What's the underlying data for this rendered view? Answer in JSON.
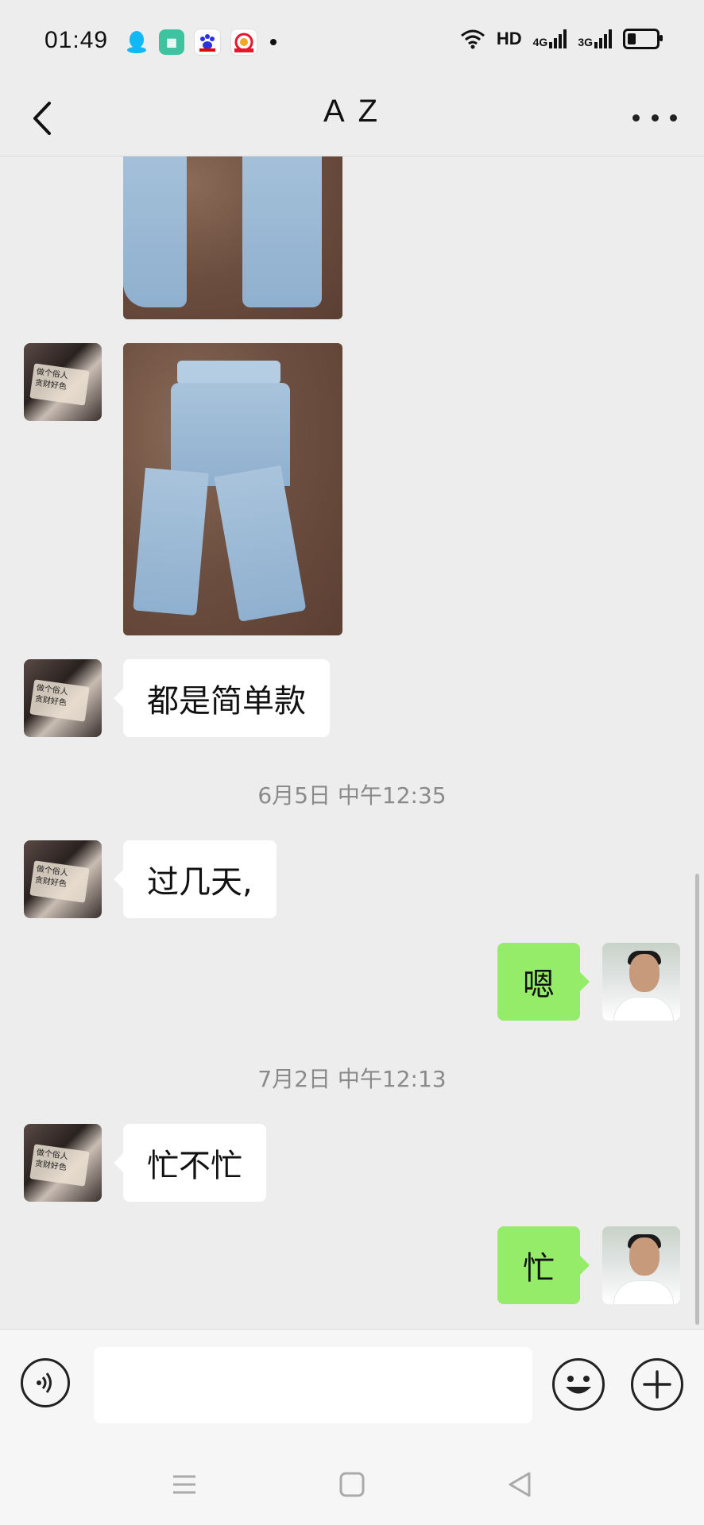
{
  "status_bar": {
    "time": "01:49",
    "app_icons": [
      "qq-icon",
      "app-store-icon",
      "baidu-icon",
      "weibo-icon"
    ],
    "hd_label": "HD",
    "network_1": "4G",
    "network_2": "3G",
    "battery_level": 0.3
  },
  "header": {
    "title": "A Z"
  },
  "messages": [
    {
      "type": "image",
      "side": "left",
      "image_desc": "jeans-photo"
    },
    {
      "type": "image",
      "side": "left",
      "image_desc": "jeans-photo"
    },
    {
      "type": "text",
      "side": "left",
      "text": "都是简单款"
    },
    {
      "type": "timestamp",
      "text": "6月5日 中午12:35"
    },
    {
      "type": "text",
      "side": "left",
      "text": "过几天,"
    },
    {
      "type": "text",
      "side": "right",
      "text": "嗯"
    },
    {
      "type": "timestamp",
      "text": "7月2日 中午12:13"
    },
    {
      "type": "text",
      "side": "left",
      "text": "忙不忙"
    },
    {
      "type": "text",
      "side": "right",
      "text": "忙"
    }
  ],
  "avatar_left_caption": [
    "做个俗人",
    "贪财好色"
  ],
  "input_bar": {
    "value": "",
    "voice_icon": "voice-icon",
    "emoji_icon": "emoji-icon",
    "plus_icon": "plus-icon"
  },
  "nav_bar": {
    "icons": [
      "menu-icon",
      "home-icon",
      "back-triangle-icon"
    ]
  },
  "colors": {
    "background": "#ededed",
    "sent_bubble": "#95ec69",
    "received_bubble": "#ffffff"
  }
}
